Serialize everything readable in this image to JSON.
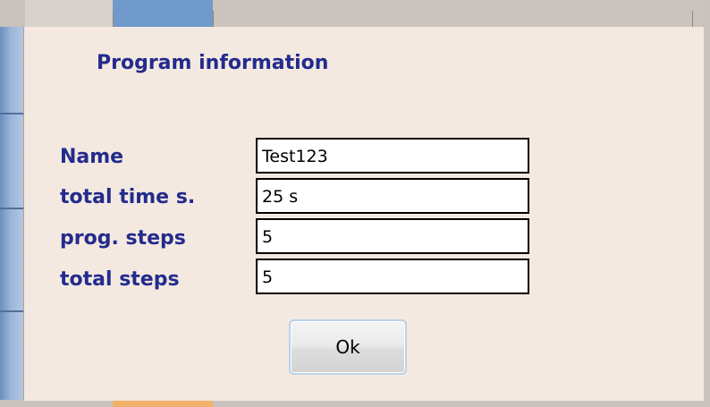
{
  "dialog": {
    "title": "Program information",
    "fields": [
      {
        "label": "Name",
        "value": "Test123"
      },
      {
        "label": "total time s.",
        "value": "25 s"
      },
      {
        "label": "prog. steps",
        "value": "5"
      },
      {
        "label": "total steps",
        "value": "5"
      }
    ],
    "ok_label": "Ok"
  },
  "colors": {
    "label_text": "#232b8c",
    "dialog_background": "#f3e9e1",
    "field_border": "#000000",
    "button_border": "#b9d3ea"
  }
}
